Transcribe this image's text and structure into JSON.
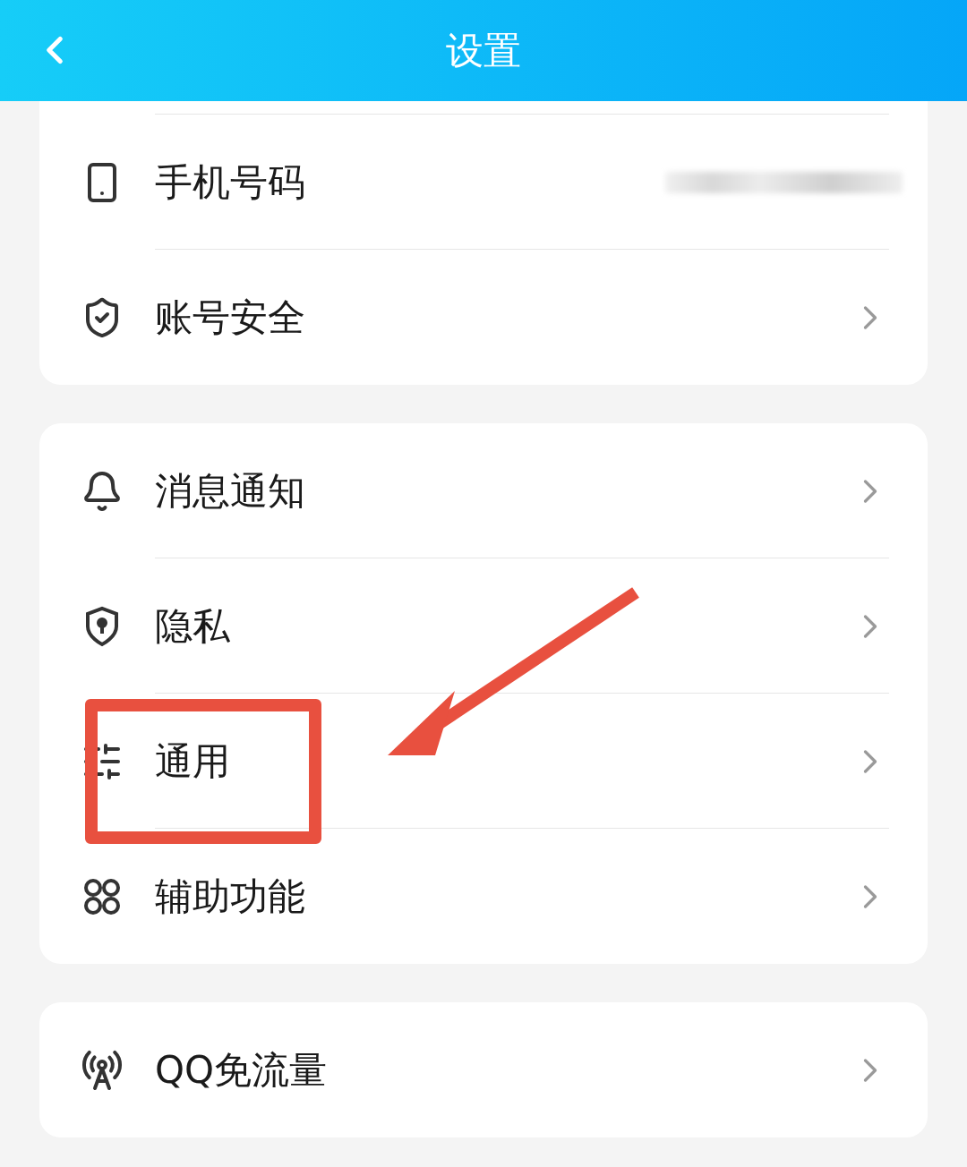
{
  "header": {
    "title": "设置"
  },
  "sections": [
    {
      "cut_top": true,
      "rows": [
        {
          "label": "手机号码",
          "kind": "masked"
        },
        {
          "label": "账号安全",
          "kind": "link"
        }
      ]
    },
    {
      "cut_top": false,
      "rows": [
        {
          "label": "消息通知",
          "kind": "link"
        },
        {
          "label": "隐私",
          "kind": "link"
        },
        {
          "label": "通用",
          "kind": "link"
        },
        {
          "label": "辅助功能",
          "kind": "link"
        }
      ]
    },
    {
      "cut_top": false,
      "rows": [
        {
          "label": "QQ免流量",
          "kind": "link"
        }
      ]
    }
  ],
  "annotation_box": true,
  "annotation_arrow": true
}
